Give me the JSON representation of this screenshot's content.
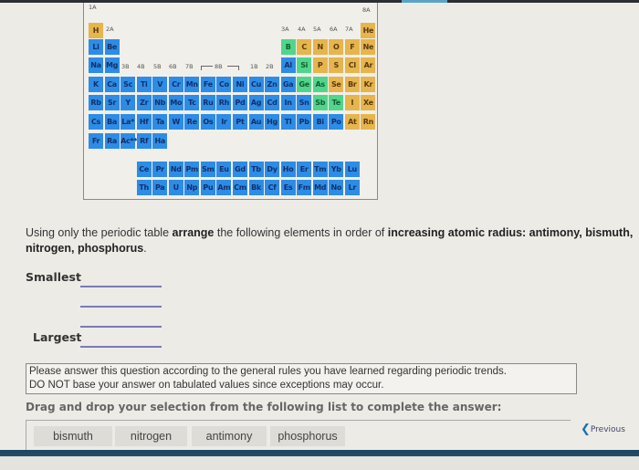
{
  "periodic_table": {
    "group_labels": {
      "g1": "1A",
      "g2": "2A",
      "g3": "3B",
      "g4": "4B",
      "g5": "5B",
      "g6": "6B",
      "g7": "7B",
      "g8": "8B",
      "g11": "1B",
      "g12": "2B",
      "g13": "3A",
      "g14": "4A",
      "g15": "5A",
      "g16": "6A",
      "g17": "7A",
      "g18": "8A"
    },
    "colors": {
      "metal": "#2d8ce6",
      "nonmetal": "#e6b54d",
      "metalloid": "#4fd68a"
    },
    "elements": [
      {
        "s": "H",
        "r": 1,
        "c": 1,
        "t": "nonmetal"
      },
      {
        "s": "He",
        "r": 1,
        "c": 18,
        "t": "nonmetal"
      },
      {
        "s": "Li",
        "r": 2,
        "c": 1,
        "t": "metal"
      },
      {
        "s": "Be",
        "r": 2,
        "c": 2,
        "t": "metal"
      },
      {
        "s": "B",
        "r": 2,
        "c": 13,
        "t": "metalloid"
      },
      {
        "s": "C",
        "r": 2,
        "c": 14,
        "t": "nonmetal"
      },
      {
        "s": "N",
        "r": 2,
        "c": 15,
        "t": "nonmetal"
      },
      {
        "s": "O",
        "r": 2,
        "c": 16,
        "t": "nonmetal"
      },
      {
        "s": "F",
        "r": 2,
        "c": 17,
        "t": "nonmetal"
      },
      {
        "s": "Ne",
        "r": 2,
        "c": 18,
        "t": "nonmetal"
      },
      {
        "s": "Na",
        "r": 3,
        "c": 1,
        "t": "metal"
      },
      {
        "s": "Mg",
        "r": 3,
        "c": 2,
        "t": "metal"
      },
      {
        "s": "Al",
        "r": 3,
        "c": 13,
        "t": "metal"
      },
      {
        "s": "Si",
        "r": 3,
        "c": 14,
        "t": "metalloid"
      },
      {
        "s": "P",
        "r": 3,
        "c": 15,
        "t": "nonmetal"
      },
      {
        "s": "S",
        "r": 3,
        "c": 16,
        "t": "nonmetal"
      },
      {
        "s": "Cl",
        "r": 3,
        "c": 17,
        "t": "nonmetal"
      },
      {
        "s": "Ar",
        "r": 3,
        "c": 18,
        "t": "nonmetal"
      },
      {
        "s": "K",
        "r": 4,
        "c": 1,
        "t": "metal"
      },
      {
        "s": "Ca",
        "r": 4,
        "c": 2,
        "t": "metal"
      },
      {
        "s": "Sc",
        "r": 4,
        "c": 3,
        "t": "metal"
      },
      {
        "s": "Ti",
        "r": 4,
        "c": 4,
        "t": "metal"
      },
      {
        "s": "V",
        "r": 4,
        "c": 5,
        "t": "metal"
      },
      {
        "s": "Cr",
        "r": 4,
        "c": 6,
        "t": "metal"
      },
      {
        "s": "Mn",
        "r": 4,
        "c": 7,
        "t": "metal"
      },
      {
        "s": "Fe",
        "r": 4,
        "c": 8,
        "t": "metal"
      },
      {
        "s": "Co",
        "r": 4,
        "c": 9,
        "t": "metal"
      },
      {
        "s": "Ni",
        "r": 4,
        "c": 10,
        "t": "metal"
      },
      {
        "s": "Cu",
        "r": 4,
        "c": 11,
        "t": "metal"
      },
      {
        "s": "Zn",
        "r": 4,
        "c": 12,
        "t": "metal"
      },
      {
        "s": "Ga",
        "r": 4,
        "c": 13,
        "t": "metal"
      },
      {
        "s": "Ge",
        "r": 4,
        "c": 14,
        "t": "metalloid"
      },
      {
        "s": "As",
        "r": 4,
        "c": 15,
        "t": "metalloid"
      },
      {
        "s": "Se",
        "r": 4,
        "c": 16,
        "t": "nonmetal"
      },
      {
        "s": "Br",
        "r": 4,
        "c": 17,
        "t": "nonmetal"
      },
      {
        "s": "Kr",
        "r": 4,
        "c": 18,
        "t": "nonmetal"
      },
      {
        "s": "Rb",
        "r": 5,
        "c": 1,
        "t": "metal"
      },
      {
        "s": "Sr",
        "r": 5,
        "c": 2,
        "t": "metal"
      },
      {
        "s": "Y",
        "r": 5,
        "c": 3,
        "t": "metal"
      },
      {
        "s": "Zr",
        "r": 5,
        "c": 4,
        "t": "metal"
      },
      {
        "s": "Nb",
        "r": 5,
        "c": 5,
        "t": "metal"
      },
      {
        "s": "Mo",
        "r": 5,
        "c": 6,
        "t": "metal"
      },
      {
        "s": "Tc",
        "r": 5,
        "c": 7,
        "t": "metal"
      },
      {
        "s": "Ru",
        "r": 5,
        "c": 8,
        "t": "metal"
      },
      {
        "s": "Rh",
        "r": 5,
        "c": 9,
        "t": "metal"
      },
      {
        "s": "Pd",
        "r": 5,
        "c": 10,
        "t": "metal"
      },
      {
        "s": "Ag",
        "r": 5,
        "c": 11,
        "t": "metal"
      },
      {
        "s": "Cd",
        "r": 5,
        "c": 12,
        "t": "metal"
      },
      {
        "s": "In",
        "r": 5,
        "c": 13,
        "t": "metal"
      },
      {
        "s": "Sn",
        "r": 5,
        "c": 14,
        "t": "metal"
      },
      {
        "s": "Sb",
        "r": 5,
        "c": 15,
        "t": "metalloid"
      },
      {
        "s": "Te",
        "r": 5,
        "c": 16,
        "t": "metalloid"
      },
      {
        "s": "I",
        "r": 5,
        "c": 17,
        "t": "nonmetal"
      },
      {
        "s": "Xe",
        "r": 5,
        "c": 18,
        "t": "nonmetal"
      },
      {
        "s": "Cs",
        "r": 6,
        "c": 1,
        "t": "metal"
      },
      {
        "s": "Ba",
        "r": 6,
        "c": 2,
        "t": "metal"
      },
      {
        "s": "La*",
        "r": 6,
        "c": 3,
        "t": "metal"
      },
      {
        "s": "Hf",
        "r": 6,
        "c": 4,
        "t": "metal"
      },
      {
        "s": "Ta",
        "r": 6,
        "c": 5,
        "t": "metal"
      },
      {
        "s": "W",
        "r": 6,
        "c": 6,
        "t": "metal"
      },
      {
        "s": "Re",
        "r": 6,
        "c": 7,
        "t": "metal"
      },
      {
        "s": "Os",
        "r": 6,
        "c": 8,
        "t": "metal"
      },
      {
        "s": "Ir",
        "r": 6,
        "c": 9,
        "t": "metal"
      },
      {
        "s": "Pt",
        "r": 6,
        "c": 10,
        "t": "metal"
      },
      {
        "s": "Au",
        "r": 6,
        "c": 11,
        "t": "metal"
      },
      {
        "s": "Hg",
        "r": 6,
        "c": 12,
        "t": "metal"
      },
      {
        "s": "Tl",
        "r": 6,
        "c": 13,
        "t": "metal"
      },
      {
        "s": "Pb",
        "r": 6,
        "c": 14,
        "t": "metal"
      },
      {
        "s": "Bi",
        "r": 6,
        "c": 15,
        "t": "metal"
      },
      {
        "s": "Po",
        "r": 6,
        "c": 16,
        "t": "metal"
      },
      {
        "s": "At",
        "r": 6,
        "c": 17,
        "t": "nonmetal"
      },
      {
        "s": "Rn",
        "r": 6,
        "c": 18,
        "t": "nonmetal"
      },
      {
        "s": "Fr",
        "r": 7,
        "c": 1,
        "t": "metal"
      },
      {
        "s": "Ra",
        "r": 7,
        "c": 2,
        "t": "metal"
      },
      {
        "s": "Ac**",
        "r": 7,
        "c": 3,
        "t": "metal"
      },
      {
        "s": "Rf",
        "r": 7,
        "c": 4,
        "t": "metal"
      },
      {
        "s": "Ha",
        "r": 7,
        "c": 5,
        "t": "metal"
      },
      {
        "s": "Ce",
        "r": 8,
        "c": 4,
        "t": "metal"
      },
      {
        "s": "Pr",
        "r": 8,
        "c": 5,
        "t": "metal"
      },
      {
        "s": "Nd",
        "r": 8,
        "c": 6,
        "t": "metal"
      },
      {
        "s": "Pm",
        "r": 8,
        "c": 7,
        "t": "metal"
      },
      {
        "s": "Sm",
        "r": 8,
        "c": 8,
        "t": "metal"
      },
      {
        "s": "Eu",
        "r": 8,
        "c": 9,
        "t": "metal"
      },
      {
        "s": "Gd",
        "r": 8,
        "c": 10,
        "t": "metal"
      },
      {
        "s": "Tb",
        "r": 8,
        "c": 11,
        "t": "metal"
      },
      {
        "s": "Dy",
        "r": 8,
        "c": 12,
        "t": "metal"
      },
      {
        "s": "Ho",
        "r": 8,
        "c": 13,
        "t": "metal"
      },
      {
        "s": "Er",
        "r": 8,
        "c": 14,
        "t": "metal"
      },
      {
        "s": "Tm",
        "r": 8,
        "c": 15,
        "t": "metal"
      },
      {
        "s": "Yb",
        "r": 8,
        "c": 16,
        "t": "metal"
      },
      {
        "s": "Lu",
        "r": 8,
        "c": 17,
        "t": "metal"
      },
      {
        "s": "Th",
        "r": 9,
        "c": 4,
        "t": "metal"
      },
      {
        "s": "Pa",
        "r": 9,
        "c": 5,
        "t": "metal"
      },
      {
        "s": "U",
        "r": 9,
        "c": 6,
        "t": "metal"
      },
      {
        "s": "Np",
        "r": 9,
        "c": 7,
        "t": "metal"
      },
      {
        "s": "Pu",
        "r": 9,
        "c": 8,
        "t": "metal"
      },
      {
        "s": "Am",
        "r": 9,
        "c": 9,
        "t": "metal"
      },
      {
        "s": "Cm",
        "r": 9,
        "c": 10,
        "t": "metal"
      },
      {
        "s": "Bk",
        "r": 9,
        "c": 11,
        "t": "metal"
      },
      {
        "s": "Cf",
        "r": 9,
        "c": 12,
        "t": "metal"
      },
      {
        "s": "Es",
        "r": 9,
        "c": 13,
        "t": "metal"
      },
      {
        "s": "Fm",
        "r": 9,
        "c": 14,
        "t": "metal"
      },
      {
        "s": "Md",
        "r": 9,
        "c": 15,
        "t": "metal"
      },
      {
        "s": "No",
        "r": 9,
        "c": 16,
        "t": "metal"
      },
      {
        "s": "Lr",
        "r": 9,
        "c": 17,
        "t": "metal"
      }
    ]
  },
  "question": {
    "part1": "Using only the periodic table ",
    "bold1": "arrange",
    "part2": " the following elements in order of ",
    "bold2": "increasing atomic radius: antimony, bismuth, nitrogen, phosphorus",
    "part3": "."
  },
  "answer_slots": {
    "smallest_label": "Smallest",
    "largest_label": "Largest",
    "values": [
      "",
      "",
      "",
      ""
    ]
  },
  "note": {
    "line1": "Please answer this question according to the general rules you have learned regarding periodic trends.",
    "line2": "DO NOT base your answer on tabulated values since exceptions may occur."
  },
  "instructions": "Drag and drop your selection from the following list to complete the answer:",
  "choices": [
    "bismuth",
    "nitrogen",
    "antimony",
    "phosphorus"
  ],
  "nav": {
    "previous_label": "Previous"
  }
}
